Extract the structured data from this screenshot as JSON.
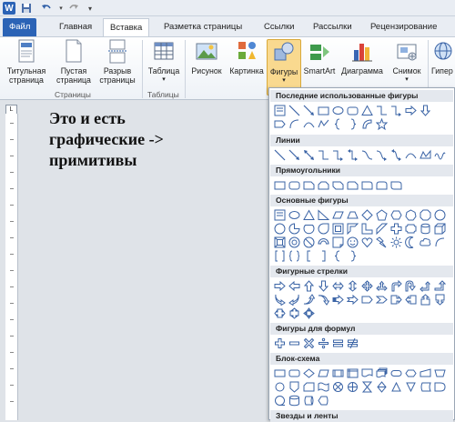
{
  "titlebar": {
    "quick_access": [
      "word-logo-icon",
      "save-icon",
      "undo-icon",
      "separator",
      "redo-icon",
      "customize-icon"
    ]
  },
  "tabs": [
    "Файл",
    "Главная",
    "Вставка",
    "Разметка страницы",
    "Ссылки",
    "Рассылки",
    "Рецензирование"
  ],
  "active_tab": "Вставка",
  "ribbon": {
    "title_page": "Титульная страница",
    "blank_page": "Пустая страница",
    "page_break": "Разрыв страницы",
    "group_pages": "Страницы",
    "table": "Таблица",
    "group_tables": "Таблицы",
    "picture": "Рисунок",
    "clipart": "Картинка",
    "shapes": "Фигуры",
    "smartart": "SmartArt",
    "chart": "Диаграмма",
    "screenshot": "Снимок",
    "hyperlink": "Гипер"
  },
  "document": {
    "text": "Это и есть\nграфические ->\nпримитивы",
    "ruler_corner": "L"
  },
  "shapes_panel": {
    "sections": [
      {
        "title": "Последние использованные фигуры",
        "rows": [
          11,
          8
        ]
      },
      {
        "title": "Линии",
        "rows": [
          12
        ]
      },
      {
        "title": "Прямоугольники",
        "rows": [
          9
        ]
      },
      {
        "title": "Основные фигуры",
        "rows": [
          12,
          12,
          12,
          6
        ]
      },
      {
        "title": "Фигурные стрелки",
        "rows": [
          12,
          12,
          3
        ]
      },
      {
        "title": "Фигуры для формул",
        "rows": [
          6
        ]
      },
      {
        "title": "Блок-схема",
        "rows": [
          12,
          12
        ]
      },
      {
        "title": "Звезды и ленты",
        "rows": []
      }
    ]
  },
  "colors": {
    "file_tab": "#2b63b6",
    "ribbon_border": "#c3ccd8",
    "shape_blue": "#3b64a6"
  }
}
